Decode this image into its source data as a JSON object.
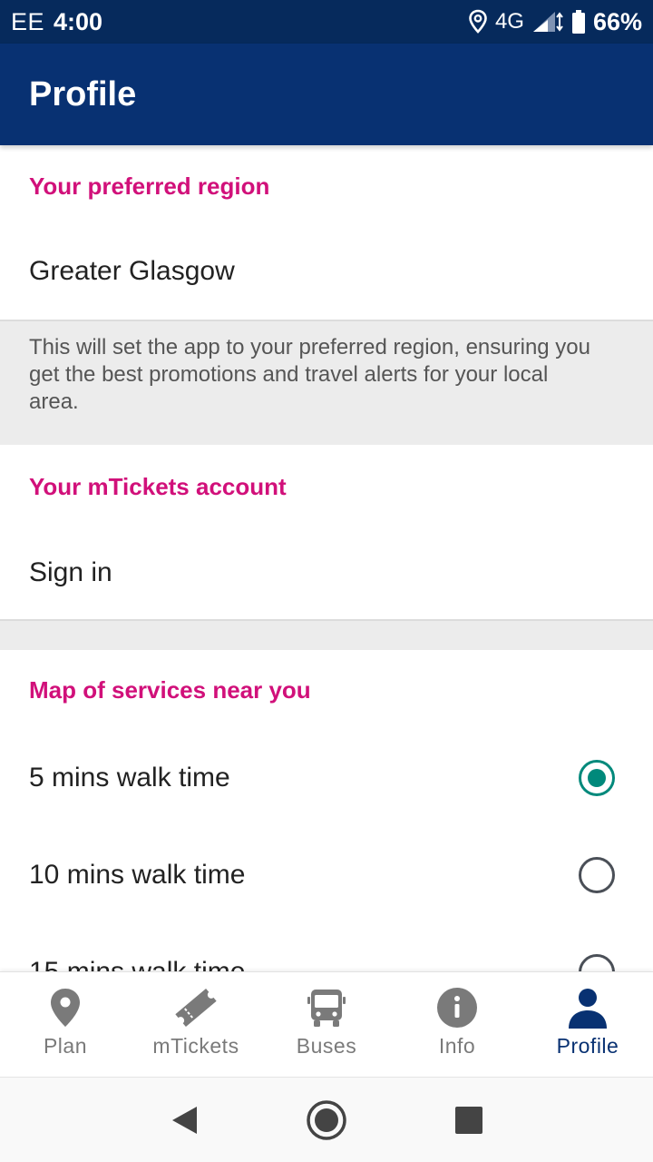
{
  "status_bar": {
    "carrier": "EE",
    "time": "4:00",
    "network": "4G",
    "battery": "66%"
  },
  "app_bar": {
    "title": "Profile"
  },
  "region": {
    "header": "Your preferred region",
    "value": "Greater Glasgow",
    "note": "This will set the app to your preferred region, ensuring you get the best promotions and travel alerts for your local area."
  },
  "account": {
    "header": "Your mTickets account",
    "sign_in": "Sign in"
  },
  "map": {
    "header": "Map of services near you",
    "options": [
      {
        "label": "5 mins walk time",
        "selected": true
      },
      {
        "label": "10 mins walk time",
        "selected": false
      },
      {
        "label": "15 mins walk time",
        "selected": false
      }
    ]
  },
  "bottom_nav": {
    "active_color": "#083172",
    "inactive_color": "#7a7a7a",
    "items": [
      {
        "label": "Plan",
        "icon": "map-pin-icon",
        "active": false
      },
      {
        "label": "mTickets",
        "icon": "ticket-icon",
        "active": false
      },
      {
        "label": "Buses",
        "icon": "bus-icon",
        "active": false
      },
      {
        "label": "Info",
        "icon": "info-icon",
        "active": false
      },
      {
        "label": "Profile",
        "icon": "person-icon",
        "active": true
      }
    ]
  },
  "colors": {
    "status_bar_bg": "#062a5c",
    "app_bar_bg": "#083172",
    "section_header": "#d1107a",
    "radio_selected": "#00897b"
  }
}
